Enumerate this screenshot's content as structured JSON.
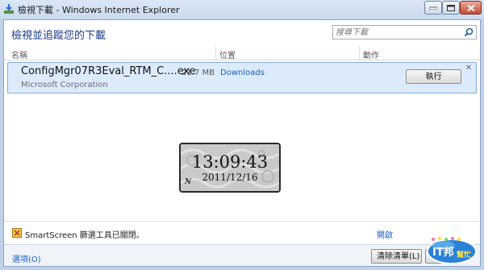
{
  "window": {
    "title": "檢視下載 - Windows Internet Explorer"
  },
  "header": {
    "title": "檢視並追蹤您的下載"
  },
  "search": {
    "placeholder": "搜尋下載"
  },
  "columns": {
    "name": "名稱",
    "location": "位置",
    "actions": "動作"
  },
  "download": {
    "file_name": "ConfigMgr07R3Eval_RTM_C....exe",
    "publisher": "Microsoft Corporation",
    "size": "21.7 MB",
    "location": "Downloads",
    "run_label": "執行"
  },
  "clock": {
    "time": "13:09:43",
    "date": "2011/12/16",
    "corner_mark": "N"
  },
  "smartscreen": {
    "text": "SmartScreen 篩選工具已關閉。",
    "link": "開啟"
  },
  "footer": {
    "options_label": "選項(O)",
    "clear_label": "清除清單(L)"
  },
  "watermark": {
    "text": "IT邦幫忙"
  },
  "colors": {
    "accent_blue": "#1c3a8a",
    "link_blue": "#1a5dc2",
    "row_highlight": "#dcebfc"
  }
}
